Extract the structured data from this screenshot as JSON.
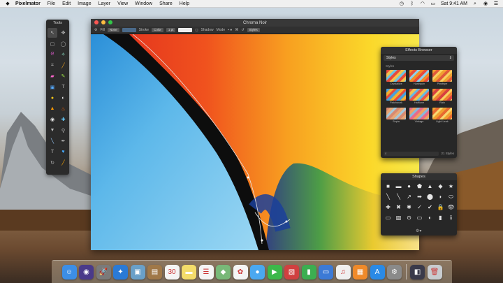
{
  "menubar": {
    "items": [
      "Pixelmator",
      "File",
      "Edit",
      "Image",
      "Layer",
      "View",
      "Window",
      "Share",
      "Help"
    ],
    "clock": "Sat 9:41 AM"
  },
  "tools": {
    "title": "Tools",
    "icons": [
      "arrow-move",
      "selection-magic",
      "rect-select",
      "ellipse-select",
      "lasso",
      "magic-wand",
      "crop",
      "eyedropper",
      "eraser",
      "pencil",
      "shape",
      "text",
      "paint-bucket",
      "brush",
      "gradient",
      "blur",
      "eye",
      "clone",
      "pen",
      "line",
      "sponge",
      "dodge",
      "type",
      "heart",
      "rotate",
      "zoom"
    ]
  },
  "document": {
    "title": "Chroma Noir",
    "options": {
      "fill_label": "Fill",
      "fill_value": "None",
      "stroke_label": "Stroke",
      "stroke_value": "Color",
      "stroke_size": "1 pt",
      "shadow_label": "Shadow",
      "mode_label": "Mode",
      "styles_button": "Styles"
    }
  },
  "effects_browser": {
    "title": "Effects Browser",
    "category": "Styles",
    "section": "Styles",
    "items": [
      {
        "label": "Crystallize",
        "colors": [
          "#e84a3a",
          "#f2c14e",
          "#6cc3e0"
        ]
      },
      {
        "label": "Harlequin",
        "colors": [
          "#f28c28",
          "#e84a3a",
          "#8fd0e8"
        ]
      },
      {
        "label": "Pinstripe",
        "colors": [
          "#f0a030",
          "#e05a3a",
          "#f8d060"
        ]
      },
      {
        "label": "Patchwork",
        "colors": [
          "#4aa0d8",
          "#f2b032",
          "#e84a3a"
        ]
      },
      {
        "label": "Halftone",
        "colors": [
          "#e8584a",
          "#f2c24e",
          "#68b8e0"
        ]
      },
      {
        "label": "Rain",
        "colors": [
          "#f08030",
          "#d84040",
          "#f8d060"
        ]
      },
      {
        "label": "Sepia",
        "colors": [
          "#d88a70",
          "#e8a878",
          "#a8c8d8"
        ]
      },
      {
        "label": "Vintage",
        "colors": [
          "#e86a8a",
          "#f0a060",
          "#8ab8d8"
        ]
      },
      {
        "label": "Light Leak",
        "colors": [
          "#f2a030",
          "#e86a30",
          "#f8d870"
        ]
      }
    ],
    "count": "21 Styles"
  },
  "shapes_panel": {
    "title": "Shapes",
    "icons": [
      "■",
      "▬",
      "●",
      "⬟",
      "▲",
      "◆",
      "★",
      "╲",
      "╲",
      "↗",
      "➡",
      "⬤",
      "◗",
      "⬭",
      "✚",
      "✖",
      "✱",
      "✓",
      "✔",
      "🔒",
      "👁",
      "▭",
      "▧",
      "⊙",
      "▭",
      "◐",
      "▮",
      "ℹ"
    ]
  },
  "dock": {
    "apps": [
      {
        "name": "finder",
        "glyph": "☺",
        "color": "#3c8ee6"
      },
      {
        "name": "siri",
        "glyph": "◉",
        "color": "#4a3a8a"
      },
      {
        "name": "launchpad",
        "glyph": "🚀",
        "color": "#7a7a7a"
      },
      {
        "name": "safari",
        "glyph": "✦",
        "color": "#2a7ad6"
      },
      {
        "name": "preview",
        "glyph": "▣",
        "color": "#6aa0c8"
      },
      {
        "name": "notes-brown",
        "glyph": "▤",
        "color": "#a07848"
      },
      {
        "name": "calendar",
        "glyph": "30",
        "color": "#f4f4f4"
      },
      {
        "name": "notes",
        "glyph": "▬",
        "color": "#f4dc6a"
      },
      {
        "name": "reminders",
        "glyph": "☰",
        "color": "#f4f4f4"
      },
      {
        "name": "maps",
        "glyph": "◆",
        "color": "#78b878"
      },
      {
        "name": "photos",
        "glyph": "✿",
        "color": "#f4f4f4"
      },
      {
        "name": "messages",
        "glyph": "●",
        "color": "#4aa8f0"
      },
      {
        "name": "facetime",
        "glyph": "▶",
        "color": "#3cb84a"
      },
      {
        "name": "photo-booth",
        "glyph": "▧",
        "color": "#d04040"
      },
      {
        "name": "numbers",
        "glyph": "▮",
        "color": "#3cae50"
      },
      {
        "name": "keynote",
        "glyph": "▭",
        "color": "#3c7ad6"
      },
      {
        "name": "music",
        "glyph": "♫",
        "color": "#f0f0f0"
      },
      {
        "name": "books",
        "glyph": "▦",
        "color": "#f08a2a"
      },
      {
        "name": "app-store",
        "glyph": "A",
        "color": "#2a8ae6"
      },
      {
        "name": "system-preferences",
        "glyph": "⚙",
        "color": "#8a8a8a"
      },
      {
        "name": "pixelmator",
        "glyph": "◧",
        "color": "#3a3a4a"
      },
      {
        "name": "trash",
        "glyph": "🗑",
        "color": "#c8ccd0"
      }
    ]
  }
}
